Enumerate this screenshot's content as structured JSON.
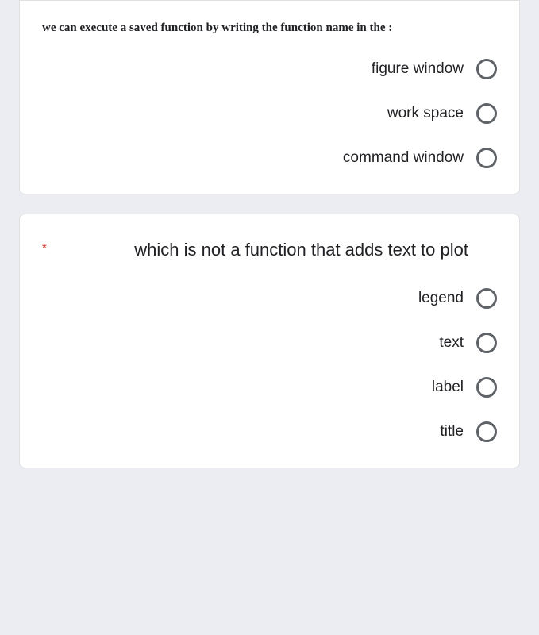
{
  "question1": {
    "text": "we can execute a saved function by writing the function name in the :",
    "options": [
      {
        "label": "figure window"
      },
      {
        "label": "work space"
      },
      {
        "label": "command window"
      }
    ]
  },
  "question2": {
    "required_marker": "*",
    "text": "which is not a function that adds text to plot",
    "options": [
      {
        "label": "legend"
      },
      {
        "label": "text"
      },
      {
        "label": "label"
      },
      {
        "label": "title"
      }
    ]
  }
}
